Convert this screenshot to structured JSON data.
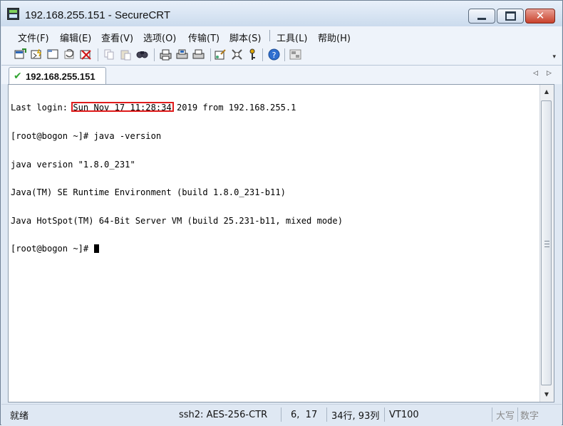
{
  "window": {
    "title": "192.168.255.151 - SecureCRT",
    "app_icon": "securecrt-terminal-icon",
    "controls": {
      "minimize": "minimize-icon",
      "maximize": "maximize-icon",
      "close": "close-icon",
      "close_glyph": "✕"
    }
  },
  "menu": {
    "items": [
      {
        "label": "文件(F)"
      },
      {
        "label": "编辑(E)"
      },
      {
        "label": "查看(V)"
      },
      {
        "label": "选项(O)"
      },
      {
        "label": "传输(T)"
      },
      {
        "label": "脚本(S)"
      },
      {
        "label": "工具(L)"
      },
      {
        "label": "帮助(H)"
      }
    ]
  },
  "toolbar": {
    "icons": [
      "connect-icon",
      "quick-connect-icon",
      "connect-tab-icon",
      "reconnect-icon",
      "disconnect-icon",
      "copy-icon",
      "paste-icon",
      "find-icon",
      "print-icon",
      "print-selection-icon",
      "print-setup-icon",
      "session-options-icon",
      "global-options-icon",
      "keymap-icon",
      "help-icon",
      "sftp-icon"
    ],
    "overflow_glyph": "▾"
  },
  "tabs": {
    "items": [
      {
        "label": "192.168.255.151",
        "status_icon": "connected-check-icon",
        "status_glyph": "✔"
      }
    ],
    "prev_glyph": "◁",
    "next_glyph": "▷"
  },
  "terminal": {
    "lines": [
      "Last login: Sun Nov 17 11:28:34 2019 from 192.168.255.1",
      "[root@bogon ~]# java -version",
      "java version \"1.8.0_231\"",
      "Java(TM) SE Runtime Environment (build 1.8.0_231-b11)",
      "Java HotSpot(TM) 64-Bit Server VM (build 25.231-b11, mixed mode)",
      "[root@bogon ~]# "
    ],
    "highlight_color": "#e01c1c",
    "scroll_up_glyph": "▲",
    "scroll_down_glyph": "▼"
  },
  "status": {
    "ready": "就绪",
    "protocol": "ssh2: AES-256-CTR",
    "cursor_pos": "6,  17",
    "size": "34行, 93列",
    "emulation": "VT100",
    "caps": "大写",
    "num": "数字"
  }
}
